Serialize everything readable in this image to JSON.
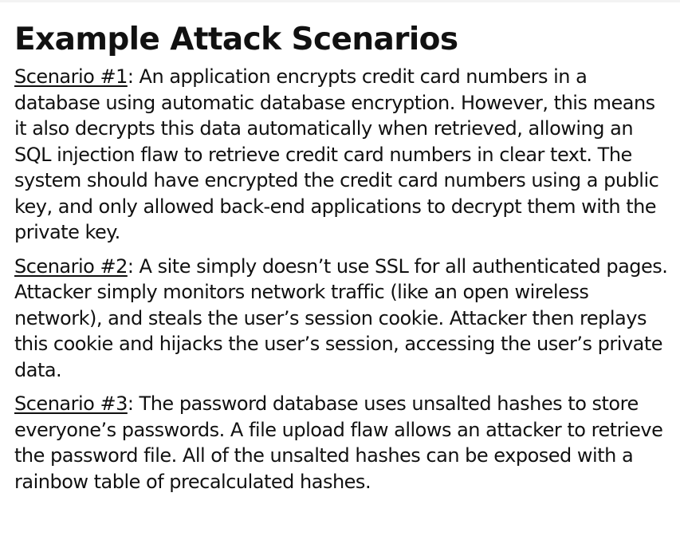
{
  "slide": {
    "title": "Example Attack Scenarios",
    "scenarios": [
      {
        "label": "Scenario #1",
        "text": ": An application encrypts credit card numbers in a database using automatic database encryption. However, this means it also decrypts this data automatically when retrieved, allowing an SQL injection flaw to retrieve credit card numbers in clear text. The system should have encrypted the credit card numbers using a public key, and only allowed back-end applications to decrypt them with the private key."
      },
      {
        "label": "Scenario #2",
        "text": ": A site simply doesn’t use SSL for all authenticated pages. Attacker simply monitors network traffic (like an open wireless network), and steals the user’s session cookie. Attacker then replays this cookie and hijacks the user’s session, accessing the user’s private data."
      },
      {
        "label": "Scenario #3",
        "text": ": The password database uses unsalted hashes to store everyone’s passwords. A file upload flaw allows an attacker to retrieve the password file. All of the unsalted hashes can be exposed with a rainbow table of precalculated hashes."
      }
    ]
  }
}
